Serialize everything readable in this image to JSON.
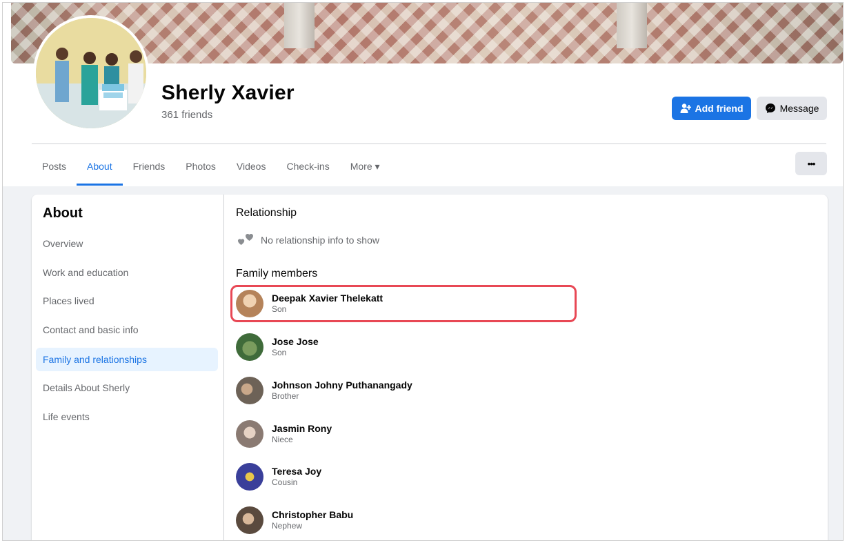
{
  "profile": {
    "name": "Sherly Xavier",
    "friends_count": "361 friends"
  },
  "actions": {
    "add_friend_label": "Add friend",
    "message_label": "Message",
    "more_options_label": "•••"
  },
  "tabs": [
    {
      "label": "Posts"
    },
    {
      "label": "About"
    },
    {
      "label": "Friends"
    },
    {
      "label": "Photos"
    },
    {
      "label": "Videos"
    },
    {
      "label": "Check-ins"
    },
    {
      "label": "More ▾"
    }
  ],
  "about": {
    "title": "About",
    "nav": [
      {
        "label": "Overview"
      },
      {
        "label": "Work and education"
      },
      {
        "label": "Places lived"
      },
      {
        "label": "Contact and basic info"
      },
      {
        "label": "Family and relationships"
      },
      {
        "label": "Details About Sherly"
      },
      {
        "label": "Life events"
      }
    ],
    "relationship_title": "Relationship",
    "no_relationship_text": "No relationship info to show",
    "family_title": "Family members",
    "members": [
      {
        "name": "Deepak Xavier Thelekatt",
        "relation": "Son",
        "avatar_color": "#b5835a"
      },
      {
        "name": "Jose Jose",
        "relation": "Son",
        "avatar_color": "#3f6b3a"
      },
      {
        "name": "Johnson Johny Puthanangady",
        "relation": "Brother",
        "avatar_color": "#6d6257"
      },
      {
        "name": "Jasmin Rony",
        "relation": "Niece",
        "avatar_color": "#8a7a72"
      },
      {
        "name": "Teresa Joy",
        "relation": "Cousin",
        "avatar_color": "#3a3f9a"
      },
      {
        "name": "Christopher Babu",
        "relation": "Nephew",
        "avatar_color": "#5a4a3e"
      }
    ]
  },
  "colors": {
    "accent": "#1b74e4",
    "highlight_border": "#e84855"
  }
}
